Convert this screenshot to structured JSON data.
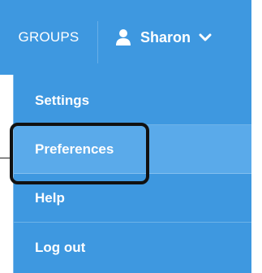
{
  "navbar": {
    "groups_label": "GROUPS",
    "user_name": "Sharon",
    "background_color": "#3e98e0",
    "user_icon": "user-icon",
    "dropdown_icon": "chevron-down-icon"
  },
  "dropdown": {
    "items": [
      {
        "label": "Settings"
      },
      {
        "label": "Preferences",
        "highlighted": true
      },
      {
        "label": "Help"
      },
      {
        "label": "Log out"
      }
    ]
  }
}
